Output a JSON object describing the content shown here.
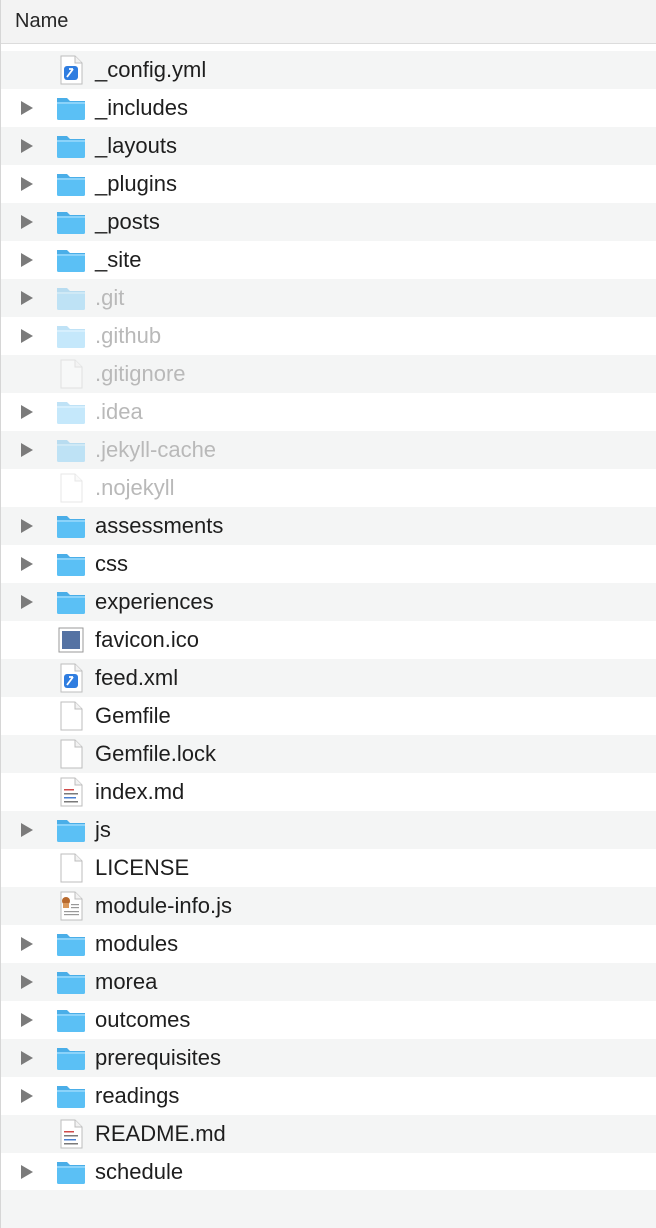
{
  "header": {
    "name_label": "Name"
  },
  "colors": {
    "folder": "#5bc0f5",
    "hidden_text": "#b9b9b9",
    "row_alt": "#f4f5f5"
  },
  "items": [
    {
      "name": "_config.yml",
      "kind": "xml",
      "expandable": false,
      "hidden": false
    },
    {
      "name": "_includes",
      "kind": "folder",
      "expandable": true,
      "hidden": false
    },
    {
      "name": "_layouts",
      "kind": "folder",
      "expandable": true,
      "hidden": false
    },
    {
      "name": "_plugins",
      "kind": "folder",
      "expandable": true,
      "hidden": false
    },
    {
      "name": "_posts",
      "kind": "folder",
      "expandable": true,
      "hidden": false
    },
    {
      "name": "_site",
      "kind": "folder",
      "expandable": true,
      "hidden": false
    },
    {
      "name": ".git",
      "kind": "folder",
      "expandable": true,
      "hidden": true
    },
    {
      "name": ".github",
      "kind": "folder",
      "expandable": true,
      "hidden": true
    },
    {
      "name": ".gitignore",
      "kind": "file",
      "expandable": false,
      "hidden": true
    },
    {
      "name": ".idea",
      "kind": "folder",
      "expandable": true,
      "hidden": true
    },
    {
      "name": ".jekyll-cache",
      "kind": "folder",
      "expandable": true,
      "hidden": true
    },
    {
      "name": ".nojekyll",
      "kind": "file",
      "expandable": false,
      "hidden": true
    },
    {
      "name": "assessments",
      "kind": "folder",
      "expandable": true,
      "hidden": false
    },
    {
      "name": "css",
      "kind": "folder",
      "expandable": true,
      "hidden": false
    },
    {
      "name": "experiences",
      "kind": "folder",
      "expandable": true,
      "hidden": false
    },
    {
      "name": "favicon.ico",
      "kind": "ico",
      "expandable": false,
      "hidden": false
    },
    {
      "name": "feed.xml",
      "kind": "xml",
      "expandable": false,
      "hidden": false
    },
    {
      "name": "Gemfile",
      "kind": "file",
      "expandable": false,
      "hidden": false
    },
    {
      "name": "Gemfile.lock",
      "kind": "file",
      "expandable": false,
      "hidden": false
    },
    {
      "name": "index.md",
      "kind": "text",
      "expandable": false,
      "hidden": false
    },
    {
      "name": "js",
      "kind": "folder",
      "expandable": true,
      "hidden": false
    },
    {
      "name": "LICENSE",
      "kind": "file",
      "expandable": false,
      "hidden": false
    },
    {
      "name": "module-info.js",
      "kind": "script",
      "expandable": false,
      "hidden": false
    },
    {
      "name": "modules",
      "kind": "folder",
      "expandable": true,
      "hidden": false
    },
    {
      "name": "morea",
      "kind": "folder",
      "expandable": true,
      "hidden": false
    },
    {
      "name": "outcomes",
      "kind": "folder",
      "expandable": true,
      "hidden": false
    },
    {
      "name": "prerequisites",
      "kind": "folder",
      "expandable": true,
      "hidden": false
    },
    {
      "name": "readings",
      "kind": "folder",
      "expandable": true,
      "hidden": false
    },
    {
      "name": "README.md",
      "kind": "text",
      "expandable": false,
      "hidden": false
    },
    {
      "name": "schedule",
      "kind": "folder",
      "expandable": true,
      "hidden": false
    }
  ]
}
